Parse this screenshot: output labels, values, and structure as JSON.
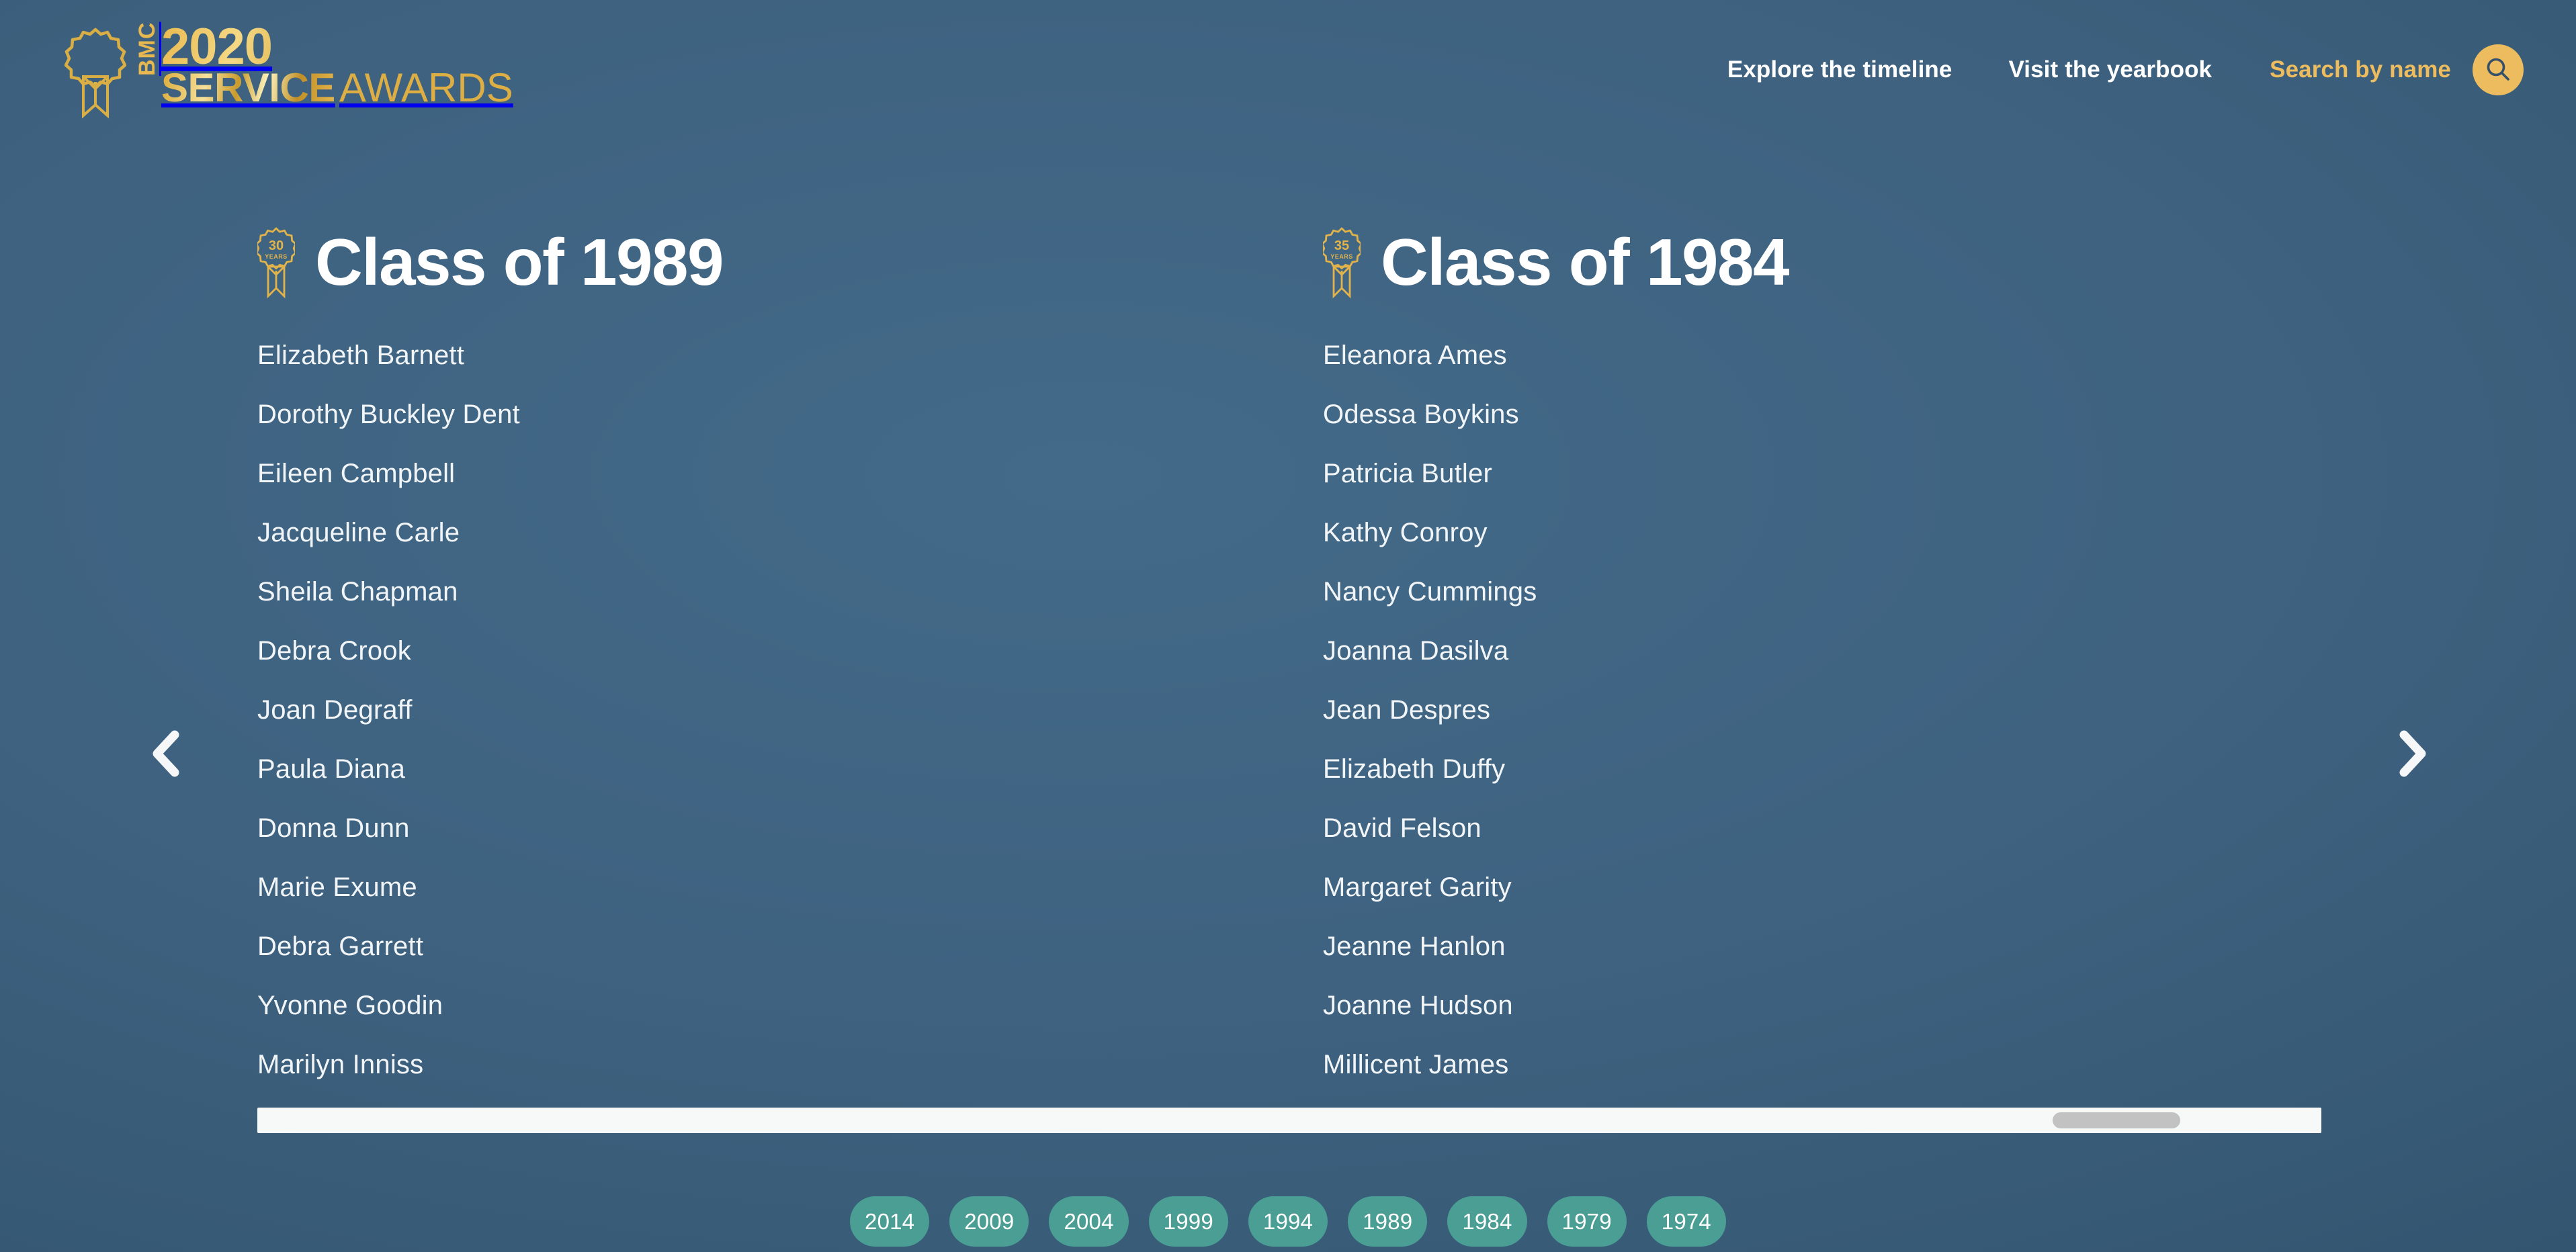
{
  "brand": {
    "bmc": "BMC",
    "year": "2020",
    "service": "SERVICE",
    "awards": "AWARDS",
    "badge_icon": "ribbon-rosette-icon",
    "gold": "#e6b84f"
  },
  "nav": {
    "items": [
      {
        "label": "Explore the timeline",
        "accent": false
      },
      {
        "label": "Visit the yearbook",
        "accent": false
      },
      {
        "label": "Search by name",
        "accent": true
      }
    ],
    "search_button": {
      "icon": "search-icon",
      "aria_label": "Search",
      "background": "#edbc5e"
    }
  },
  "carousel": {
    "prev_label": "Previous",
    "prev_icon": "chevron-left-icon",
    "next_label": "Next",
    "next_icon": "chevron-right-icon",
    "columns": [
      {
        "badge_number": "30",
        "badge_unit": "YEARS",
        "title": "Class of 1989",
        "names": [
          "Elizabeth Barnett",
          "Dorothy Buckley Dent",
          "Eileen Campbell",
          "Jacqueline Carle",
          "Sheila Chapman",
          "Debra Crook",
          "Joan Degraff",
          "Paula Diana",
          "Donna Dunn",
          "Marie Exume",
          "Debra Garrett",
          "Yvonne Goodin",
          "Marilyn Inniss"
        ]
      },
      {
        "badge_number": "35",
        "badge_unit": "YEARS",
        "title": "Class of 1984",
        "names": [
          "Eleanora Ames",
          "Odessa Boykins",
          "Patricia Butler",
          "Kathy Conroy",
          "Nancy Cummings",
          "Joanna Dasilva",
          "Jean Despres",
          "Elizabeth Duffy",
          "David Felson",
          "Margaret Garity",
          "Jeanne Hanlon",
          "Joanne Hudson",
          "Millicent James"
        ]
      }
    ]
  },
  "scrollbar": {
    "orientation": "horizontal",
    "track_color": "#f7f8f8",
    "thumb_color": "#c2c2c2"
  },
  "year_nav": {
    "years": [
      "2014",
      "2009",
      "2004",
      "1999",
      "1994",
      "1989",
      "1984",
      "1979",
      "1974"
    ],
    "pill_color": "#4a9e94"
  },
  "theme": {
    "background_start": "#436a89",
    "background_end": "#2e4c65",
    "gold_accent": "#edbc5e",
    "teal_accent": "#4a9e94",
    "text_primary": "#ffffff"
  }
}
